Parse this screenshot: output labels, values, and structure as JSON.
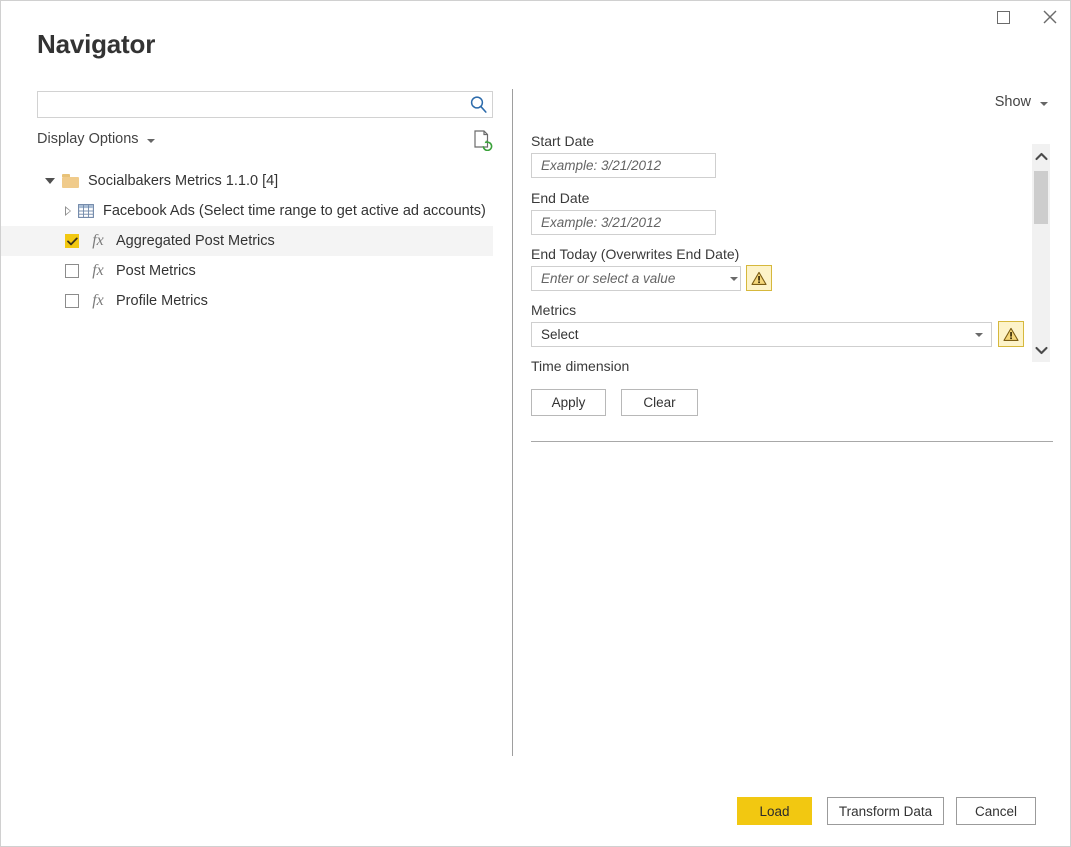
{
  "window": {
    "title": "Navigator",
    "maximize_label": "Maximize",
    "close_label": "Close"
  },
  "search": {
    "value": "",
    "placeholder": ""
  },
  "display_options": {
    "label": "Display Options"
  },
  "refresh": {
    "label": "Refresh"
  },
  "tree": [
    {
      "label": "Socialbakers Metrics 1.1.0 [4]",
      "type": "folder",
      "expanded": true,
      "level": 0,
      "checkbox": false,
      "selected": false
    },
    {
      "label": "Facebook Ads (Select time range to get active ad accounts)",
      "type": "table",
      "expanded": false,
      "level": 1,
      "checkbox": false,
      "selected": false
    },
    {
      "label": "Aggregated Post Metrics",
      "type": "function",
      "level": 1,
      "checkbox": true,
      "checked": true,
      "selected": true
    },
    {
      "label": "Post Metrics",
      "type": "function",
      "level": 1,
      "checkbox": true,
      "checked": false,
      "selected": false
    },
    {
      "label": "Profile Metrics",
      "type": "function",
      "level": 1,
      "checkbox": true,
      "checked": false,
      "selected": false
    }
  ],
  "right_pane": {
    "show": {
      "label": "Show"
    },
    "fields": [
      {
        "label": "Start Date",
        "value": "",
        "placeholder": "Example: 3/21/2012",
        "kind": "text",
        "warning": false
      },
      {
        "label": "End Date",
        "value": "",
        "placeholder": "Example: 3/21/2012",
        "kind": "text",
        "warning": false
      },
      {
        "label": "End Today (Overwrites End Date)",
        "value": "",
        "placeholder": "Enter or select a value",
        "kind": "combo",
        "warning": true
      },
      {
        "label": "Metrics",
        "value": "Select",
        "placeholder": "",
        "kind": "combo",
        "warning": true
      },
      {
        "label": "Time dimension",
        "kind": "label-only",
        "warning": false
      }
    ],
    "apply_label": "Apply",
    "clear_label": "Clear"
  },
  "footer": {
    "load_label": "Load",
    "transform_label": "Transform Data",
    "cancel_label": "Cancel"
  },
  "colors": {
    "accent": "#f2c811",
    "warning_border": "#d6b83c",
    "warning_fill": "#fdf3c9",
    "search_icon": "#2c6bab",
    "folder": "#f0cb8b"
  }
}
